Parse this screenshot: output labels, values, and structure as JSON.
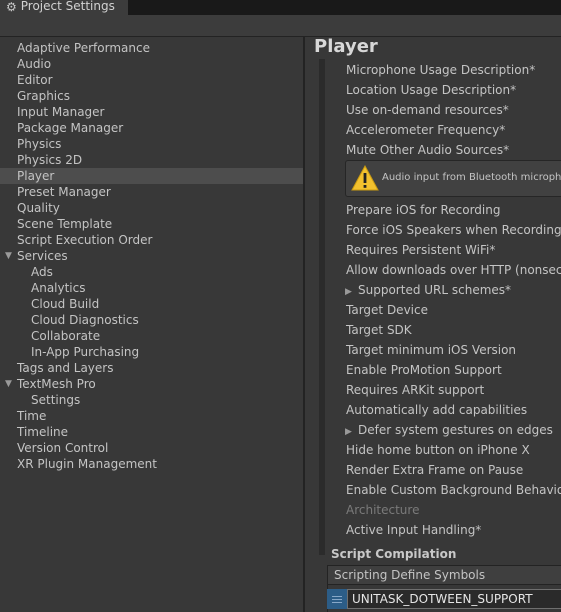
{
  "window": {
    "tab_title": "Project Settings",
    "tab_icon": "gear-icon"
  },
  "sidebar": {
    "items": [
      {
        "label": "Adaptive Performance",
        "level": 0
      },
      {
        "label": "Audio",
        "level": 0
      },
      {
        "label": "Editor",
        "level": 0
      },
      {
        "label": "Graphics",
        "level": 0
      },
      {
        "label": "Input Manager",
        "level": 0
      },
      {
        "label": "Package Manager",
        "level": 0
      },
      {
        "label": "Physics",
        "level": 0
      },
      {
        "label": "Physics 2D",
        "level": 0
      },
      {
        "label": "Player",
        "level": 0,
        "selected": true
      },
      {
        "label": "Preset Manager",
        "level": 0
      },
      {
        "label": "Quality",
        "level": 0
      },
      {
        "label": "Scene Template",
        "level": 0
      },
      {
        "label": "Script Execution Order",
        "level": 0
      },
      {
        "label": "Services",
        "level": 0,
        "expanded": true
      },
      {
        "label": "Ads",
        "level": 1
      },
      {
        "label": "Analytics",
        "level": 1
      },
      {
        "label": "Cloud Build",
        "level": 1
      },
      {
        "label": "Cloud Diagnostics",
        "level": 1
      },
      {
        "label": "Collaborate",
        "level": 1
      },
      {
        "label": "In-App Purchasing",
        "level": 1
      },
      {
        "label": "Tags and Layers",
        "level": 0
      },
      {
        "label": "TextMesh Pro",
        "level": 0,
        "expanded": true
      },
      {
        "label": "Settings",
        "level": 1
      },
      {
        "label": "Time",
        "level": 0
      },
      {
        "label": "Timeline",
        "level": 0
      },
      {
        "label": "Version Control",
        "level": 0
      },
      {
        "label": "XR Plugin Management",
        "level": 0
      }
    ]
  },
  "main": {
    "heading": "Player",
    "rows_top": [
      "Microphone Usage Description*",
      "Location Usage Description*",
      "Use on-demand resources*",
      "Accelerometer Frequency*",
      "Mute Other Audio Sources*"
    ],
    "help_box": {
      "icon": "warning-icon",
      "message": "Audio input from Bluetooth micropho"
    },
    "rows_mid": [
      "Prepare iOS for Recording",
      "Force iOS Speakers when Recording",
      "Requires Persistent WiFi*",
      "Allow downloads over HTTP (nonsecu"
    ],
    "foldout_url_schemes": "Supported URL schemes*",
    "rows_lower": [
      "Target Device",
      "Target SDK",
      "Target minimum iOS Version",
      "Enable ProMotion Support",
      "Requires ARKit support",
      "Automatically add capabilities"
    ],
    "foldout_gestures": "Defer system gestures on edges",
    "rows_bottom": [
      "Hide home button on iPhone X",
      "Render Extra Frame on Pause",
      "Enable Custom Background Behaviors"
    ],
    "architecture_label": "Architecture",
    "active_input_label": "Active Input Handling*",
    "script_compilation": {
      "header": "Script Compilation",
      "list_header": "Scripting Define Symbols",
      "symbols": [
        "UNITASK_DOTWEEN_SUPPORT"
      ]
    }
  },
  "colors": {
    "window_bg": "#383838",
    "selection": "#4d4d4d",
    "handle_accent": "#2c5d87",
    "warning": "#f2c12e"
  }
}
